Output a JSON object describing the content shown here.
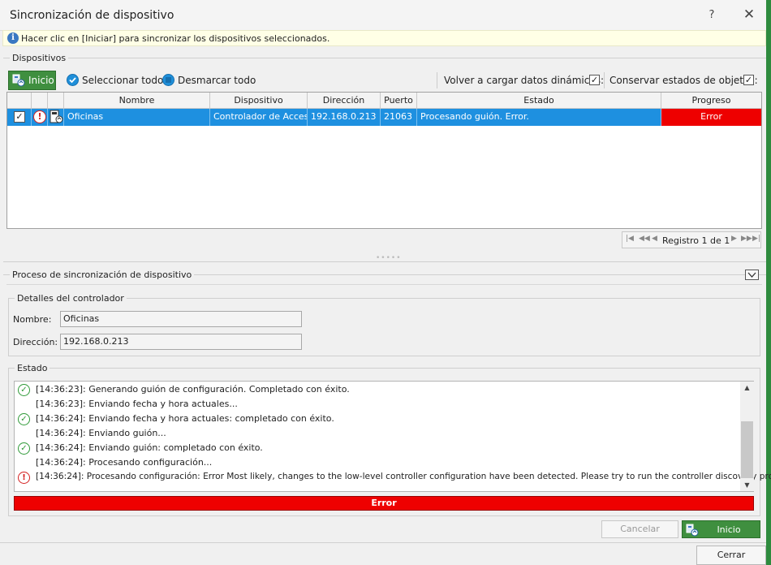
{
  "window": {
    "title": "Sincronización de dispositivo",
    "help_label": "?",
    "close_label": "✕"
  },
  "info": {
    "message": "Hacer clic en [Iniciar] para sincronizar los dispositivos seleccionados."
  },
  "devices": {
    "group_label": "Dispositivos",
    "start_label": "Inicio",
    "select_all_label": "Seleccionar todo",
    "deselect_all_label": "Desmarcar todo",
    "reload_label": "Volver a cargar datos dinámicos:",
    "reload_checked": "✓",
    "preserve_label": "Conservar estados de objetos:",
    "preserve_checked": "✓",
    "columns": {
      "name": "Nombre",
      "device": "Dispositivo",
      "address": "Dirección",
      "port": "Puerto",
      "status": "Estado",
      "progress": "Progreso"
    },
    "row": {
      "checked": "✓",
      "name": "Oficinas",
      "device": "Controlador de Acceso",
      "address": "192.168.0.213",
      "port": "21063",
      "status": "Procesando guión. Error.",
      "progress": "Error"
    },
    "pager": {
      "text": "Registro 1 de 1"
    }
  },
  "sync": {
    "group_label": "Proceso de sincronización de dispositivo",
    "details_label": "Detalles del controlador",
    "name_label": "Nombre:",
    "name_value": "Oficinas",
    "address_label": "Dirección:",
    "address_value": "192.168.0.213",
    "status_label": "Estado",
    "log": [
      {
        "icon": "ok",
        "text": "[14:36:23]: Generando guión de configuración. Completado con éxito."
      },
      {
        "icon": "none",
        "text": "[14:36:23]: Enviando fecha y hora actuales..."
      },
      {
        "icon": "ok",
        "text": "[14:36:24]: Enviando fecha y hora actuales:  completado con éxito."
      },
      {
        "icon": "none",
        "text": "[14:36:24]: Enviando guión..."
      },
      {
        "icon": "ok",
        "text": "[14:36:24]: Enviando guión: completado con éxito."
      },
      {
        "icon": "none",
        "text": "[14:36:24]: Procesando configuración..."
      },
      {
        "icon": "error",
        "text": "[14:36:24]: Procesando configuración: Error Most likely, changes to the low-level controller configuration have been detected. Please try to run the controller discovery process."
      }
    ],
    "result": "Error"
  },
  "footer": {
    "cancel_label": "Cancelar",
    "start_label": "Inicio",
    "close_label": "Cerrar"
  }
}
